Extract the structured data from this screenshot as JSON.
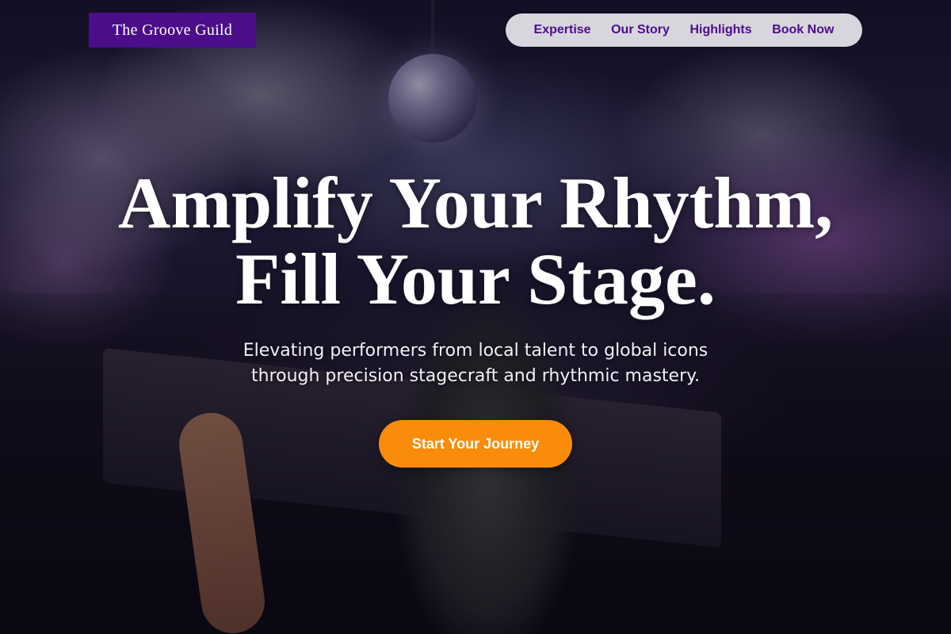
{
  "brand": {
    "logo_text": "The Groove Guild",
    "logo_color": "#4b0d8a"
  },
  "nav": {
    "items": [
      {
        "label": "Expertise"
      },
      {
        "label": "Our Story"
      },
      {
        "label": "Highlights"
      },
      {
        "label": "Book Now"
      }
    ]
  },
  "hero": {
    "headline_line1": "Amplify Your Rhythm,",
    "headline_line2": "Fill Your Stage.",
    "subtitle_line1": "Elevating performers from local talent to global icons",
    "subtitle_line2": "through precision stagecraft and rhythmic mastery.",
    "cta_label": "Start Your Journey",
    "cta_color": "#f98c0b"
  }
}
